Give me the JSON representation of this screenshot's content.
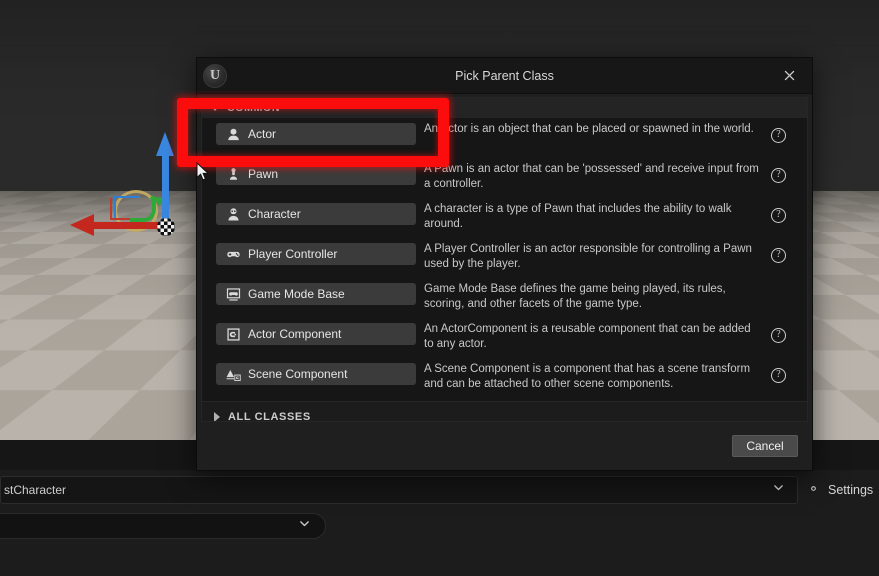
{
  "dialog": {
    "title": "Pick Parent Class",
    "logo_icon": "unreal-engine-logo",
    "close_icon": "close-icon",
    "section_common_label": "COMMON",
    "all_classes_label": "ALL CLASSES",
    "cancel_label": "Cancel",
    "classes": [
      {
        "name": "Actor",
        "icon": "actor-icon",
        "description": "An Actor is an object that can be placed or spawned in the world.",
        "has_help": true
      },
      {
        "name": "Pawn",
        "icon": "pawn-icon",
        "description": "A Pawn is an actor that can be 'possessed' and receive input from a controller.",
        "has_help": true
      },
      {
        "name": "Character",
        "icon": "character-icon",
        "description": "A character is a type of Pawn that includes the ability to walk around.",
        "has_help": true
      },
      {
        "name": "Player Controller",
        "icon": "gamepad-icon",
        "description": "A Player Controller is an actor responsible for controlling a Pawn used by the player.",
        "has_help": true
      },
      {
        "name": "Game Mode Base",
        "icon": "game-mode-icon",
        "description": "Game Mode Base defines the game being played, its rules, scoring, and other facets of the game type.",
        "has_help": false
      },
      {
        "name": "Actor Component",
        "icon": "actor-component-icon",
        "description": "An ActorComponent is a reusable component that can be added to any actor.",
        "has_help": true
      },
      {
        "name": "Scene Component",
        "icon": "scene-component-icon",
        "description": "A Scene Component is a component that has a scene transform and can be attached to other scene components.",
        "has_help": true
      }
    ]
  },
  "bottom_bar": {
    "combo_value": "stCharacter",
    "combo_chevron_icon": "chevron-down-icon",
    "settings_label": "Settings",
    "settings_icon": "gear-icon",
    "second_combo_chevron_icon": "chevron-down-icon"
  },
  "viewport": {
    "gizmo_icon": "translate-gizmo",
    "cursor_icon": "mouse-cursor"
  },
  "annotation": {
    "highlight_color": "#fb0d0d",
    "target": "Actor"
  }
}
